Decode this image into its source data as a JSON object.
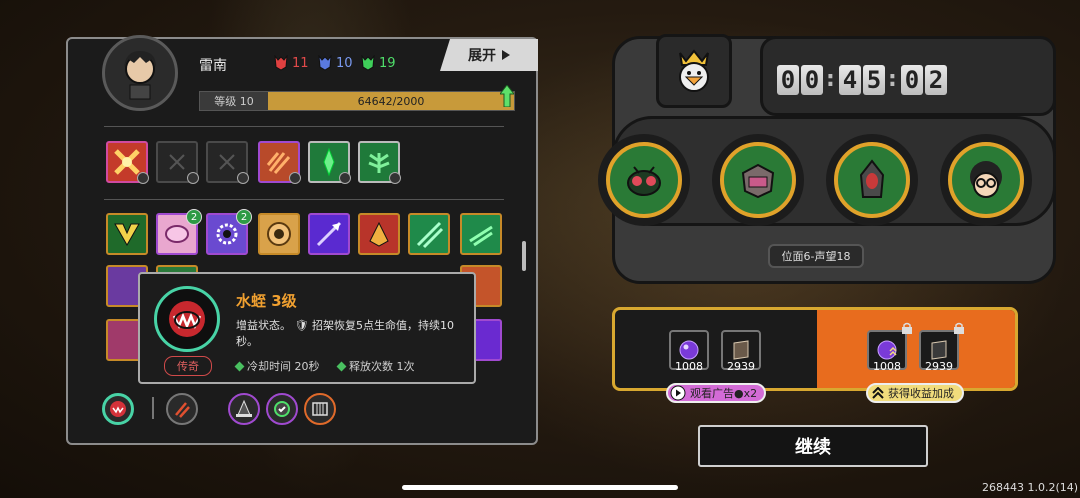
{
  "player": {
    "name": "雷南",
    "level_label": "等级 10",
    "xp_text": "64642/2000",
    "xp_fraction": 1.0
  },
  "resources": [
    {
      "name": "red-mask-icon",
      "color": "#e04040",
      "value": "11"
    },
    {
      "name": "blue-mask-icon",
      "color": "#5a7ae0",
      "value": "10"
    },
    {
      "name": "green-mask-icon",
      "color": "#3fcf5a",
      "value": "19"
    }
  ],
  "expand_label": "展开",
  "slots_row1_badges": [
    "",
    "",
    "",
    "",
    "",
    ""
  ],
  "skills_row2_badges": [
    "",
    "2",
    "2",
    "",
    "",
    "",
    "",
    ""
  ],
  "tooltip": {
    "title": "水蛭 3级",
    "description": "增益状态。 🛡 招架恢复5点生命值，持续10秒。",
    "rarity": "传奇",
    "cooldown": "冷却时间 20秒",
    "charges": "释放次数 1次"
  },
  "timer": {
    "digits": [
      "0",
      "0",
      "4",
      "5",
      "0",
      "2"
    ]
  },
  "position_label": "位面6-声望18",
  "rewards": [
    {
      "name": "purple-orb-icon",
      "count": "1008"
    },
    {
      "name": "book-icon",
      "count": "2939"
    },
    {
      "name": "purple-orb-icon",
      "count": "1008"
    },
    {
      "name": "book-icon",
      "count": "2939"
    }
  ],
  "watch_ad_label": "观看广告●x2",
  "bonus_label": "获得收益加成",
  "continue_label": "继续",
  "version": "268443 1.0.2(14)"
}
